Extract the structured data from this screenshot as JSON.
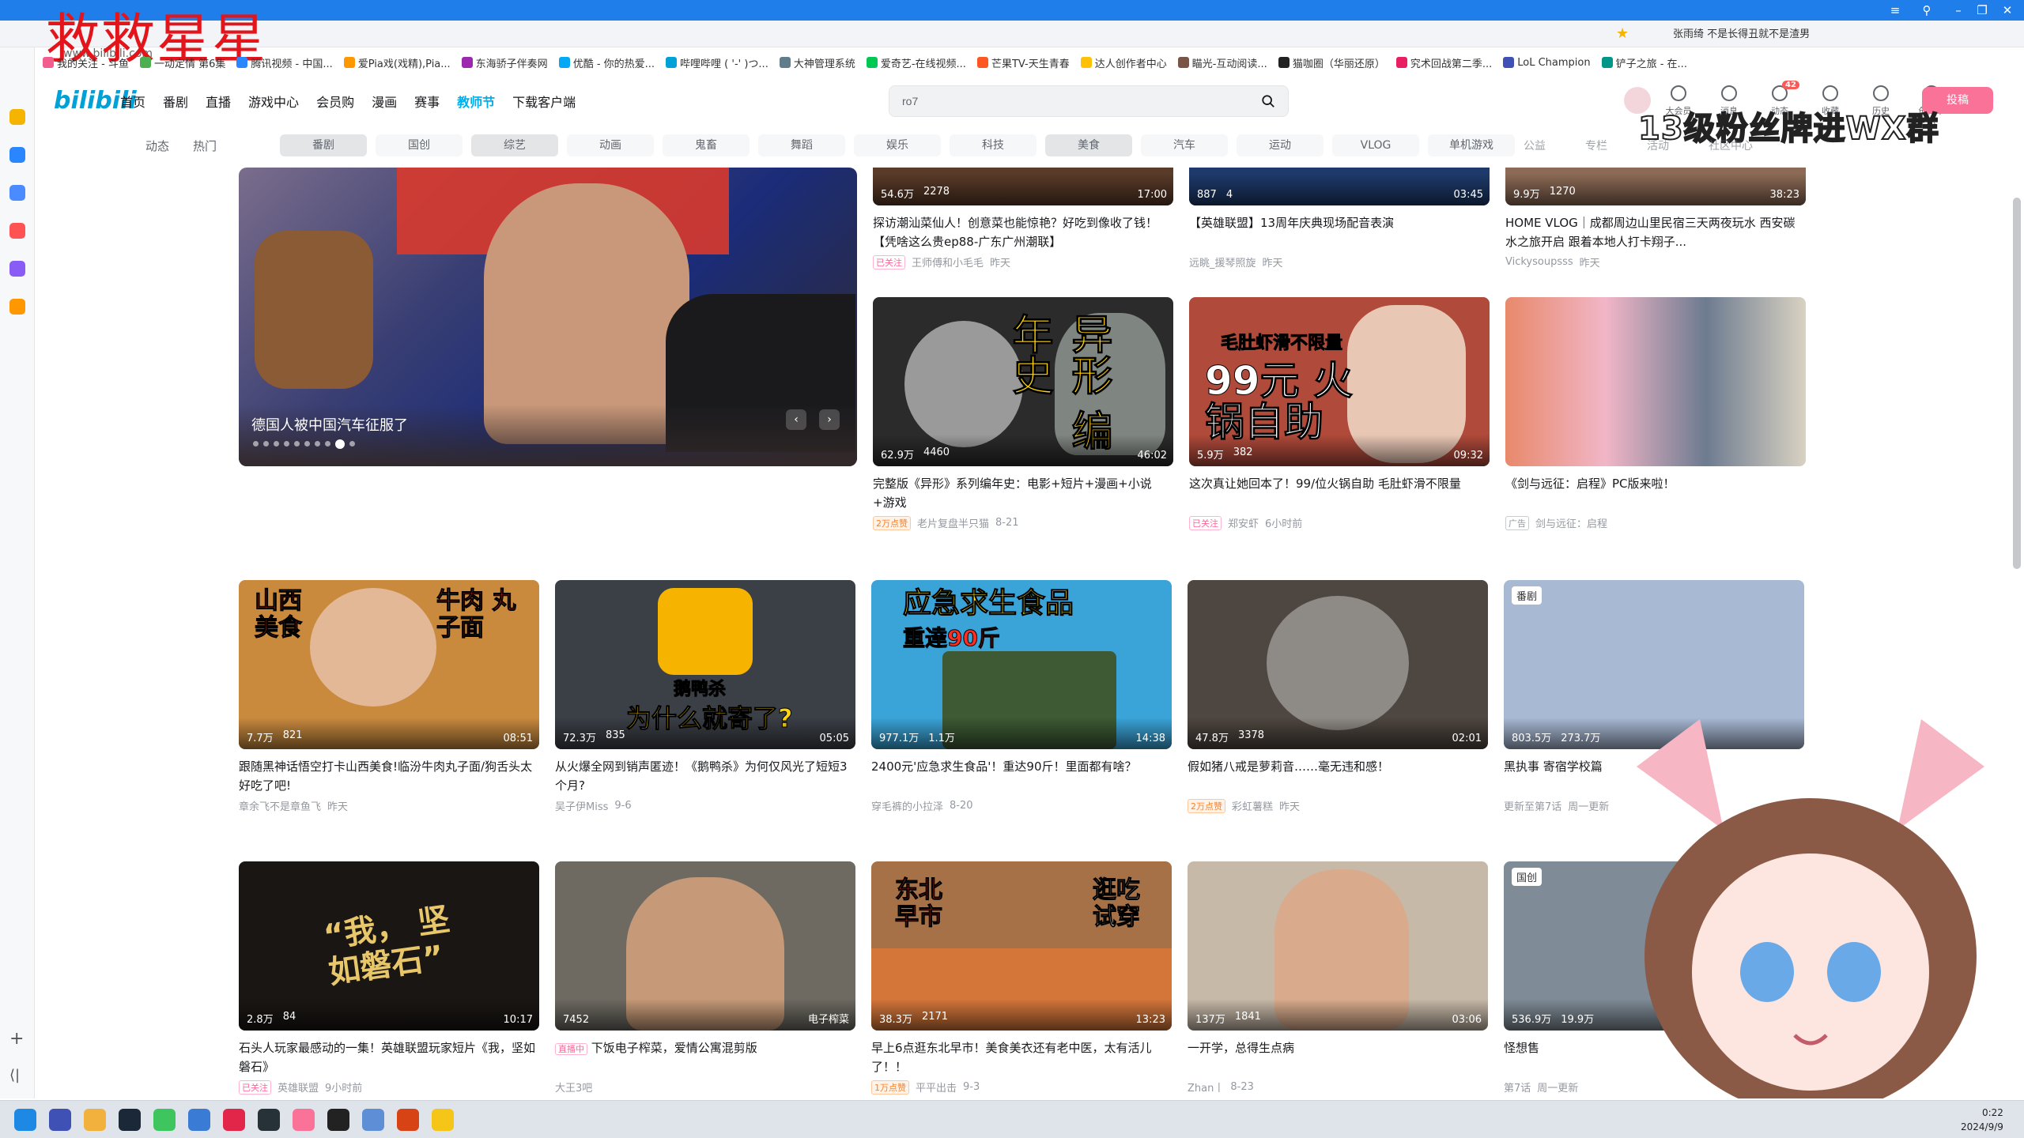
{
  "browser": {
    "tab_url": "www.bilibili.com",
    "overlay_title": "救救星星",
    "address_extra": "张雨绮 不是长得丑就不是渣男",
    "bookmarks": [
      "我的关注 - 斗鱼",
      "一动定情 第6集",
      "腾讯视频 - 中国...",
      "爱Pia戏(戏精),Pia...",
      "东海骄子伴奏网",
      "优酷 - 你的热爱...",
      "哔哩哔哩 ( '-' )つ...",
      "大神管理系统",
      "爱奇艺-在线视频...",
      "芒果TV-天生青春",
      "达人创作者中心",
      "瞄光-互动阅读...",
      "猫咖圈（华丽还原）",
      "究术回战第二季...",
      "LoL Champion",
      "铲子之旅 - 在..."
    ]
  },
  "header": {
    "logo": "bilibili",
    "nav": [
      "首页",
      "番剧",
      "直播",
      "游戏中心",
      "会员购",
      "漫画",
      "赛事",
      "教师节",
      "下载客户端"
    ],
    "search_value": "ro7",
    "right_icons": [
      "大会员",
      "消息",
      "动态",
      "收藏",
      "历史",
      "创作中心"
    ],
    "dynamic_badge": "42",
    "upload": "投稿",
    "fans_banner": "13级粉丝牌进WX群"
  },
  "channels": {
    "left": [
      "动态",
      "热门"
    ],
    "chips": [
      "番剧",
      "国创",
      "综艺",
      "动画",
      "鬼畜",
      "舞蹈",
      "娱乐",
      "科技",
      "美食",
      "汽车",
      "运动",
      "VLOG",
      "单机游戏",
      "公益",
      "专栏",
      "活动",
      "社区中心"
    ]
  },
  "carousel": {
    "title": "德国人被中国汽车征服了",
    "prev": "‹",
    "next": "›"
  },
  "cards": [
    {
      "id": "c1",
      "plays": "54.6万",
      "danmaku": "2278",
      "duration": "17:00",
      "title": "探访潮汕菜仙人！创意菜也能惊艳？好吃到像收了钱！【凭啥这么贵ep88-广东广州潮联】",
      "tag": "已关注",
      "author": "王师傅和小毛毛",
      "date": "昨天"
    },
    {
      "id": "c2",
      "plays": "887",
      "danmaku": "4",
      "duration": "03:45",
      "title": "【英雄联盟】13周年庆典现场配音表演",
      "tag": "",
      "author": "远眺_援琴照旋",
      "date": "昨天"
    },
    {
      "id": "c3",
      "plays": "9.9万",
      "danmaku": "1270",
      "duration": "38:23",
      "title": "HOME VLOG｜成都周边山里民宿三天两夜玩水 西安碳水之旅开启 跟着本地人打卡翔子...",
      "tag": "",
      "author": "Vickysoupsss",
      "date": "昨天"
    },
    {
      "id": "c4",
      "plays": "62.9万",
      "danmaku": "4460",
      "duration": "46:02",
      "title": "完整版《异形》系列编年史：电影+短片+漫画+小说+游戏",
      "tag": "2万点赞",
      "author": "老片复盘半只猫",
      "date": "8-21",
      "thumb_text": "异形 编年史"
    },
    {
      "id": "c5",
      "plays": "5.9万",
      "danmaku": "382",
      "duration": "09:32",
      "title": "这次真让她回本了！99/位火锅自助 毛肚虾滑不限量",
      "tag": "已关注",
      "author": "郑安虾",
      "date": "6小时前",
      "thumb_text": "99元 火锅自助",
      "thumb_sub": "毛肚虾滑不限量"
    },
    {
      "id": "c6",
      "plays": "",
      "danmaku": "",
      "duration": "",
      "title": "《剑与远征：启程》PC版来啦！",
      "tag": "广告",
      "author": "剑与远征：启程",
      "date": ""
    },
    {
      "id": "c7",
      "plays": "7.7万",
      "danmaku": "821",
      "duration": "08:51",
      "title": "跟随黑神话悟空打卡山西美食!临汾牛肉丸子面/狗舌头太好吃了吧!",
      "tag": "",
      "author": "章余飞不是章鱼飞",
      "date": "昨天",
      "thumb_text": "山西 美食",
      "thumb_sub": "牛肉 丸子面"
    },
    {
      "id": "c8",
      "plays": "72.3万",
      "danmaku": "835",
      "duration": "05:05",
      "title": "从火爆全网到销声匿迹！《鹅鸭杀》为何仅风光了短短3个月?",
      "tag": "",
      "author": "吴子伊Miss",
      "date": "9-6",
      "thumb_text": "鹅鸭杀",
      "thumb_sub": "为什么就寄了?"
    },
    {
      "id": "c9",
      "plays": "977.1万",
      "danmaku": "1.1万",
      "duration": "14:38",
      "title": "2400元'应急求生食品'！重达90斤！里面都有啥？",
      "tag": "",
      "author": "穿毛裤的小拉泽",
      "date": "8-20",
      "thumb_text": "应急求生食品",
      "thumb_sub": "重達90斤"
    },
    {
      "id": "c10",
      "plays": "47.8万",
      "danmaku": "3378",
      "duration": "02:01",
      "title": "假如猪八戒是萝莉音……毫无违和感！",
      "tag": "2万点赞",
      "author": "彩虹薯糕",
      "date": "昨天"
    },
    {
      "id": "c11",
      "plays": "803.5万",
      "danmaku": "273.7万",
      "duration": "",
      "title": "黑执事 寄宿学校篇",
      "tag": "",
      "author": "更新至第7话",
      "date": "周一更新",
      "badge": "番剧"
    },
    {
      "id": "c12",
      "plays": "2.8万",
      "danmaku": "84",
      "duration": "10:17",
      "title": "石头人玩家最感动的一集！英雄联盟玩家短片《我，坚如磐石》",
      "tag": "已关注",
      "author": "英雄联盟",
      "date": "9小时前",
      "thumb_text": "“我， 坚如磐石”"
    },
    {
      "id": "c13",
      "plays": "7452",
      "danmaku": "",
      "duration": "电子榨菜",
      "title": "下饭电子榨菜，爱情公寓混剪版",
      "tag": "直播中",
      "author": "大王3吧",
      "date": ""
    },
    {
      "id": "c14",
      "plays": "38.3万",
      "danmaku": "2171",
      "duration": "13:23",
      "title": "早上6点逛东北早市！美食美衣还有老中医，太有活儿了！！",
      "tag": "1万点赞",
      "author": "平平出击",
      "date": "9-3",
      "thumb_text": "东北 早市",
      "thumb_sub": "逛吃 试穿"
    },
    {
      "id": "c15",
      "plays": "137万",
      "danmaku": "1841",
      "duration": "03:06",
      "title": "一开学，总得生点病",
      "tag": "",
      "author": "Zhan丨",
      "date": "8-23"
    },
    {
      "id": "c16",
      "plays": "536.9万",
      "danmaku": "19.9万",
      "duration": "",
      "title": "怪想售",
      "tag": "",
      "author": "第7话",
      "date": "周一更新",
      "badge": "国创"
    }
  ],
  "taskbar": {
    "time": "0:22",
    "date": "2024/9/9"
  }
}
